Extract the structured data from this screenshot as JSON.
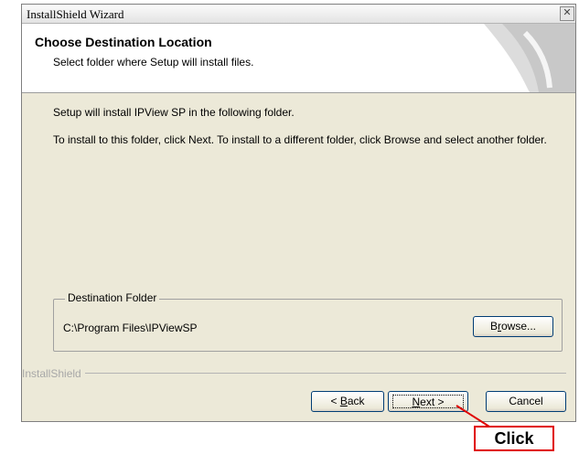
{
  "window": {
    "title": "InstallShield Wizard",
    "close_label": "✕"
  },
  "header": {
    "title": "Choose Destination Location",
    "subtitle": "Select folder where Setup will install files."
  },
  "body": {
    "line1": "Setup will install IPView SP in the following folder.",
    "line2": "To install to this folder, click Next. To install to a different folder, click Browse and select another folder."
  },
  "destination": {
    "legend": "Destination Folder",
    "path": "C:\\Program Files\\IPViewSP",
    "browse_label": "Browse...",
    "browse_accesskey": "r"
  },
  "footer": {
    "brand": "InstallShield",
    "back_label": "< Back",
    "next_label": "Next >",
    "cancel_label": "Cancel"
  },
  "annotation": {
    "label": "Click",
    "color": "#e00000"
  }
}
